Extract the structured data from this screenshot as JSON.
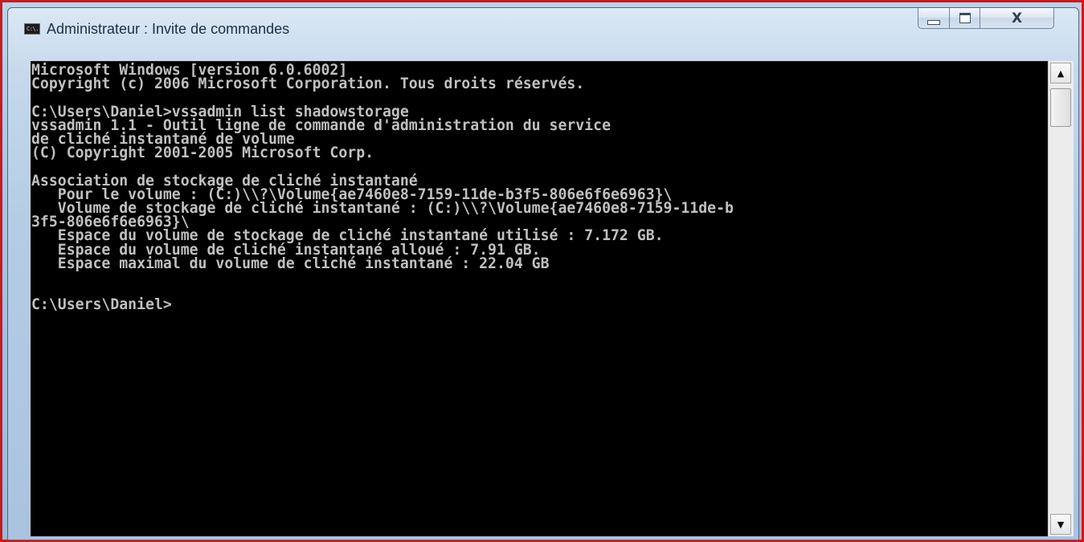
{
  "window": {
    "icon_text": "C:\\.",
    "title": "Administrateur : Invite de commandes",
    "buttons": {
      "minimize": "minimize",
      "maximize": "maximize",
      "close": "X"
    }
  },
  "console": {
    "text": "Microsoft Windows [version 6.0.6002]\nCopyright (c) 2006 Microsoft Corporation. Tous droits réservés.\n\nC:\\Users\\Daniel>vssadmin list shadowstorage\nvssadmin 1.1 - Outil ligne de commande d'administration du service\nde cliché instantané de volume\n(C) Copyright 2001-2005 Microsoft Corp.\n\nAssociation de stockage de cliché instantané\n   Pour le volume : (C:)\\\\?\\Volume{ae7460e8-7159-11de-b3f5-806e6f6e6963}\\\n   Volume de stockage de cliché instantané : (C:)\\\\?\\Volume{ae7460e8-7159-11de-b\n3f5-806e6f6e6963}\\\n   Espace du volume de stockage de cliché instantané utilisé : 7.172 GB.\n   Espace du volume de cliché instantané alloué : 7.91 GB.\n   Espace maximal du volume de cliché instantané : 22.04 GB\n\n\nC:\\Users\\Daniel>",
    "colors": {
      "background": "#000000",
      "foreground": "#c0c0c0"
    }
  },
  "scrollbar": {
    "up_arrow": "▲",
    "down_arrow": "▼"
  }
}
